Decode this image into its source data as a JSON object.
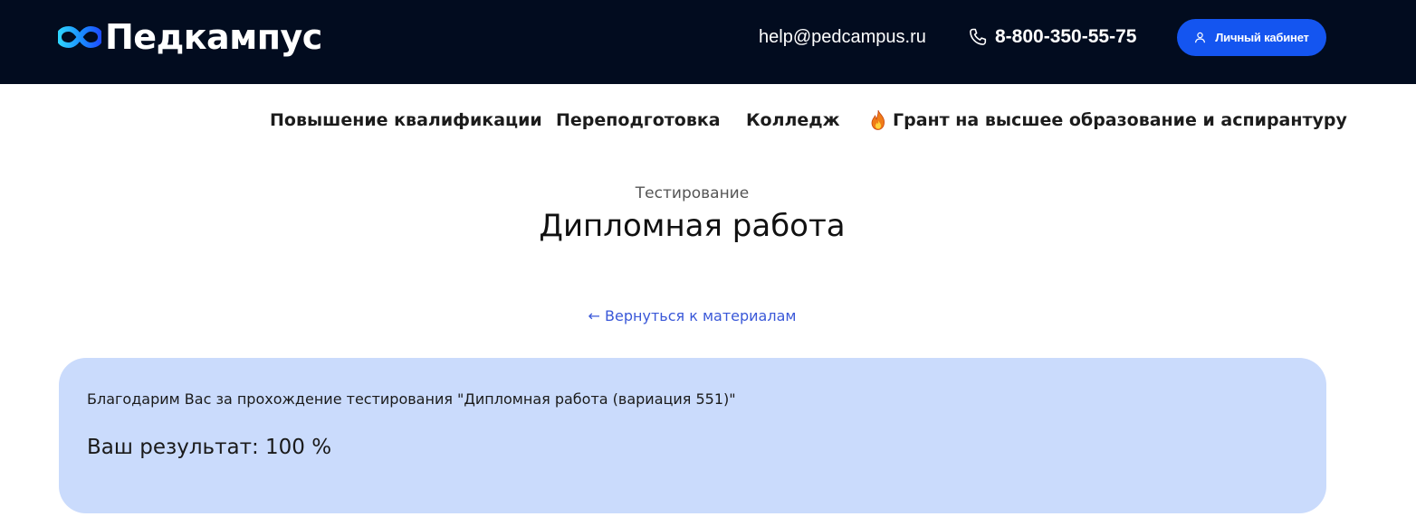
{
  "header": {
    "logo_text": "Педкампус",
    "email": "help@pedcampus.ru",
    "phone": "8-800-350-55-75",
    "cabinet_button": "Личный кабинет",
    "background_color": "#020c1f",
    "button_color": "#1455f0"
  },
  "nav": {
    "items": [
      {
        "label": "Повышение квалификации"
      },
      {
        "label": "Переподготовка"
      },
      {
        "label": "Колледж"
      },
      {
        "label": "Грант на высшее образование и аспирантуру",
        "icon": "fire-icon"
      }
    ]
  },
  "main": {
    "subtitle": "Тестирование",
    "title": "Дипломная работа",
    "back_link": "← Вернуться к материалам",
    "link_color": "#3a58d8"
  },
  "result": {
    "thanks": "Благодарим Вас за прохождение тестирования \"Дипломная работа (вариация 551)\"",
    "score": "Ваш результат: 100 %",
    "card_color": "#cadbfc"
  }
}
